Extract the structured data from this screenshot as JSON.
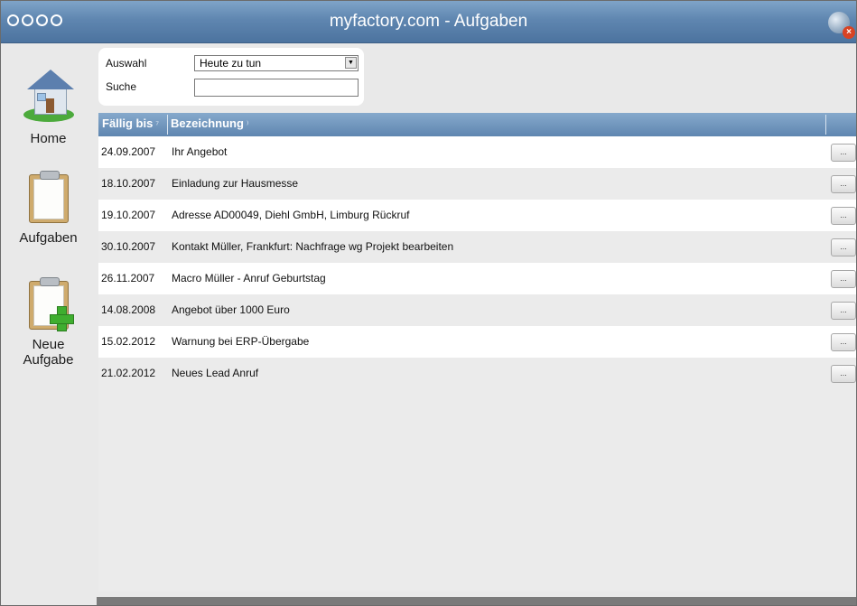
{
  "window": {
    "title": "myfactory.com - Aufgaben",
    "accent": "#5f86b0"
  },
  "nav": {
    "home_label": "Home",
    "tasks_label": "Aufgaben",
    "new_task_label_line1": "Neue",
    "new_task_label_line2": "Aufgabe"
  },
  "filter": {
    "auswahl_label": "Auswahl",
    "auswahl_value": "Heute zu tun",
    "suche_label": "Suche",
    "suche_value": ""
  },
  "table": {
    "columns": {
      "date": "Fällig bis",
      "description": "Bezeichnung"
    },
    "more_label": "...",
    "rows": [
      {
        "date": "24.09.2007",
        "description": "Ihr Angebot"
      },
      {
        "date": "18.10.2007",
        "description": "Einladung zur Hausmesse"
      },
      {
        "date": "19.10.2007",
        "description": "Adresse AD00049, Diehl GmbH, Limburg Rückruf"
      },
      {
        "date": "30.10.2007",
        "description": "Kontakt Müller, Frankfurt: Nachfrage wg Projekt bearbeiten"
      },
      {
        "date": "26.11.2007",
        "description": "Macro Müller - Anruf Geburtstag"
      },
      {
        "date": "14.08.2008",
        "description": "Angebot über 1000 Euro"
      },
      {
        "date": "15.02.2012",
        "description": "Warnung bei ERP-Übergabe"
      },
      {
        "date": "21.02.2012",
        "description": "Neues Lead Anruf"
      }
    ]
  }
}
